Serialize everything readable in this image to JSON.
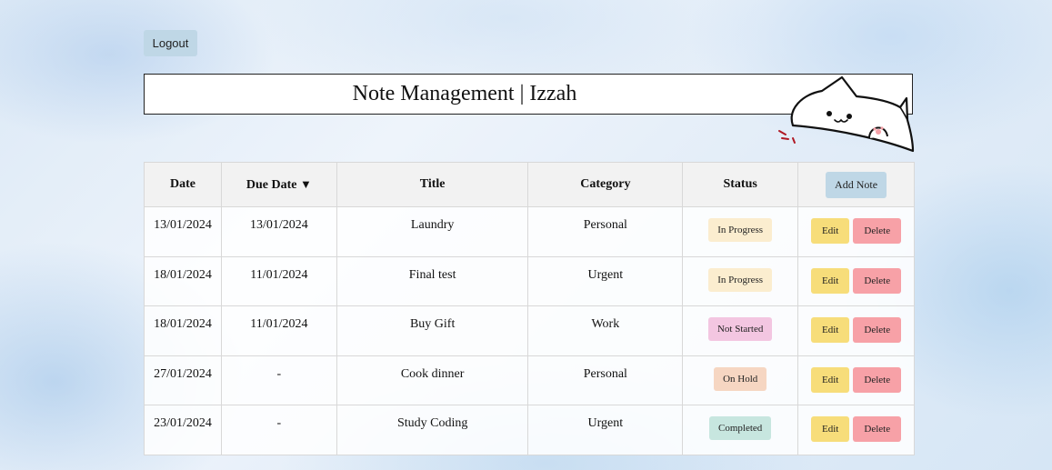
{
  "header": {
    "logout_label": "Logout",
    "title": "Note Management | Izzah"
  },
  "colors": {
    "logout_bg": "#bfd7e6",
    "edit_bg": "#f7dd7a",
    "delete_bg": "#f7a1a7",
    "status_in_progress": "#fbedcf",
    "status_not_started": "#f3c6e1",
    "status_on_hold": "#f6d6c2",
    "status_completed": "#c7e6df"
  },
  "table": {
    "headers": {
      "date": "Date",
      "due_date": "Due Date",
      "sort_indicator": "▼",
      "title": "Title",
      "category": "Category",
      "status": "Status"
    },
    "add_label": "Add Note",
    "edit_label": "Edit",
    "delete_label": "Delete",
    "rows": [
      {
        "date": "13/01/2024",
        "due": "13/01/2024",
        "title": "Laundry",
        "category": "Personal",
        "status": "In Progress",
        "status_color": "#fbedcf"
      },
      {
        "date": "18/01/2024",
        "due": "11/01/2024",
        "title": "Final test",
        "category": "Urgent",
        "status": "In Progress",
        "status_color": "#fbedcf"
      },
      {
        "date": "18/01/2024",
        "due": "11/01/2024",
        "title": "Buy Gift",
        "category": "Work",
        "status": "Not Started",
        "status_color": "#f3c6e1"
      },
      {
        "date": "27/01/2024",
        "due": "-",
        "title": "Cook dinner",
        "category": "Personal",
        "status": "On Hold",
        "status_color": "#f6d6c2"
      },
      {
        "date": "23/01/2024",
        "due": "-",
        "title": "Study Coding",
        "category": "Urgent",
        "status": "Completed",
        "status_color": "#c7e6df"
      }
    ]
  },
  "decoration": {
    "mascot_icon": "cat-mascot-icon"
  }
}
